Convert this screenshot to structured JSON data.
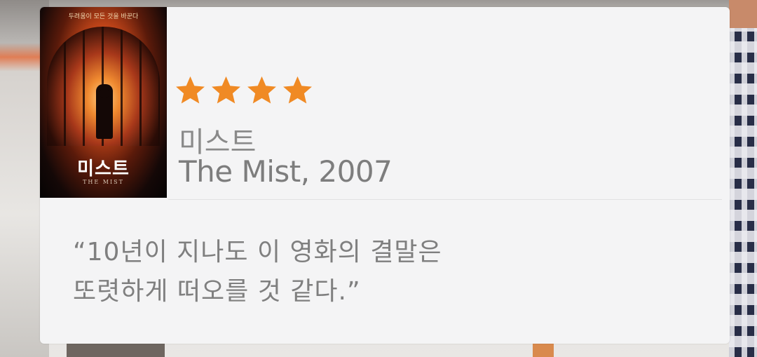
{
  "movie": {
    "poster": {
      "tagline": "두려움이 모든 것을 바꾼다",
      "title": "미스트",
      "subtitle": "THE MIST"
    },
    "rating_stars": 4,
    "star_color": "#f08a24",
    "title_ko": "미스트",
    "title_en": "The Mist, 2007"
  },
  "review": {
    "line1": "“10년이 지나도 이 영화의 결말은",
    "line2": "또렷하게 떠오를 것 같다.”"
  }
}
